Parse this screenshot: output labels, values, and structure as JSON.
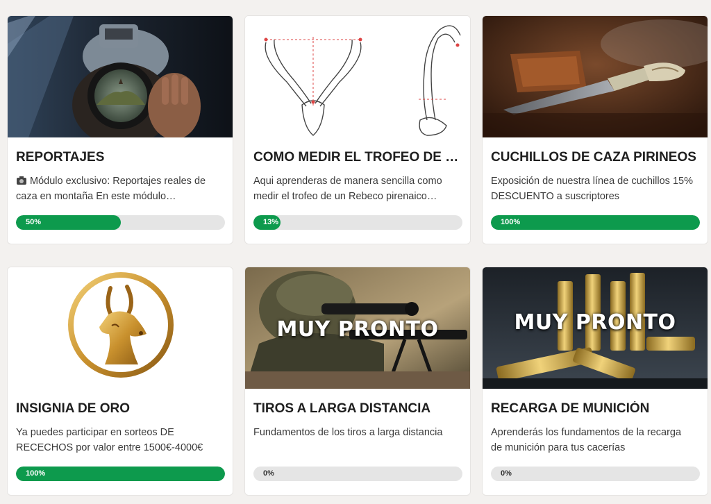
{
  "colors": {
    "progress_fill": "#0d9a4d",
    "progress_track": "#e5e5e5"
  },
  "cards": [
    {
      "title": "REPORTAJES",
      "icon": "camera-emoji-icon",
      "description": "Módulo exclusivo: Reportajes reales de caza en montaña En este módulo…",
      "progress": 50,
      "progress_label": "50%",
      "overlay": ""
    },
    {
      "title": "COMO MEDIR EL TROFEO DE UN REBECO",
      "description": "Aqui aprenderas de manera sencilla como medir el trofeo de un Rebeco pirenaico…",
      "progress": 13,
      "progress_label": "13%",
      "overlay": ""
    },
    {
      "title": "CUCHILLOS DE CAZA PIRINEOS",
      "description": "Exposición de nuestra línea de cuchillos 15% DESCUENTO a suscriptores",
      "progress": 100,
      "progress_label": "100%",
      "overlay": ""
    },
    {
      "title": "INSIGNIA DE ORO",
      "description": "Ya puedes participar en sorteos DE RECECHOS por valor entre 1500€-4000€",
      "progress": 100,
      "progress_label": "100%",
      "overlay": ""
    },
    {
      "title": "TIROS A LARGA DISTANCIA",
      "description": "Fundamentos de los tiros a larga distancia",
      "progress": 0,
      "progress_label": "0%",
      "overlay": "MUY PRONTO"
    },
    {
      "title": "RECARGA DE MUNICIÓN",
      "description": "Aprenderás los fundamentos de la recarga de munición para tus cacerías",
      "progress": 0,
      "progress_label": "0%",
      "overlay": "MUY PRONTO"
    }
  ]
}
